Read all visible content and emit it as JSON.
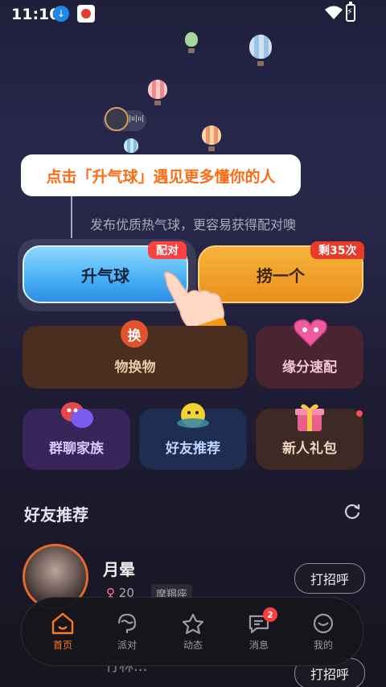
{
  "status_bar": {
    "time": "11:10"
  },
  "tooltip": {
    "text": "点击「升气球」遇见更多懂你的人"
  },
  "subtitle": "发布优质热气球，更容易获得配对噢",
  "main_buttons": {
    "rise": {
      "label": "升气球",
      "badge": "配对"
    },
    "fish": {
      "label": "捞一个",
      "badge": "剩35次"
    }
  },
  "features": [
    {
      "label": "物换物",
      "icon_char": "换"
    },
    {
      "label": "缘分速配"
    },
    {
      "label": "群聊家族"
    },
    {
      "label": "好友推荐"
    },
    {
      "label": "新人礼包"
    }
  ],
  "friends_section": {
    "title": "好友推荐",
    "friend": {
      "name": "月晕",
      "age": "20",
      "zodiac": "摩羯座",
      "action": "打招呼"
    },
    "next_action": "打招呼",
    "next_name": "竹林..."
  },
  "tabs": [
    {
      "label": "首页",
      "icon": "home-icon",
      "active": true
    },
    {
      "label": "派对",
      "icon": "party-icon"
    },
    {
      "label": "动态",
      "icon": "star-icon"
    },
    {
      "label": "消息",
      "icon": "message-icon",
      "badge": "2"
    },
    {
      "label": "我的",
      "icon": "profile-icon"
    }
  ],
  "colors": {
    "accent": "#ff7a1a",
    "tooltip_text": "#ff6a13",
    "badge_red": "#ff4040"
  }
}
